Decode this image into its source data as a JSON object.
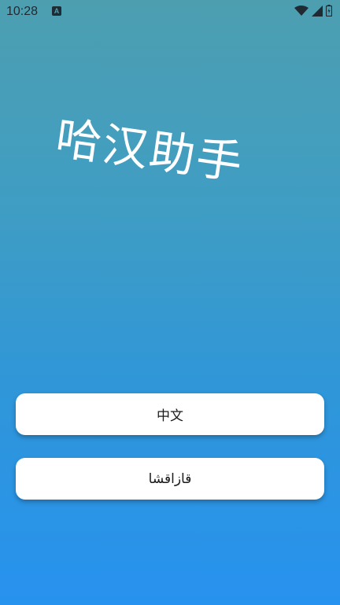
{
  "status_bar": {
    "time": "10:28",
    "notification_icon": "a-icon",
    "icons": [
      "wifi-icon",
      "cell-signal-icon",
      "battery-icon"
    ]
  },
  "app": {
    "title": "哈汉助手"
  },
  "buttons": {
    "chinese_label": "中文",
    "kazakh_label": "قازاقشا"
  },
  "colors": {
    "gradient_top": "#4d9fb0",
    "gradient_bottom": "#2792ef",
    "button_bg": "#ffffff",
    "title_text": "#ffffff"
  }
}
